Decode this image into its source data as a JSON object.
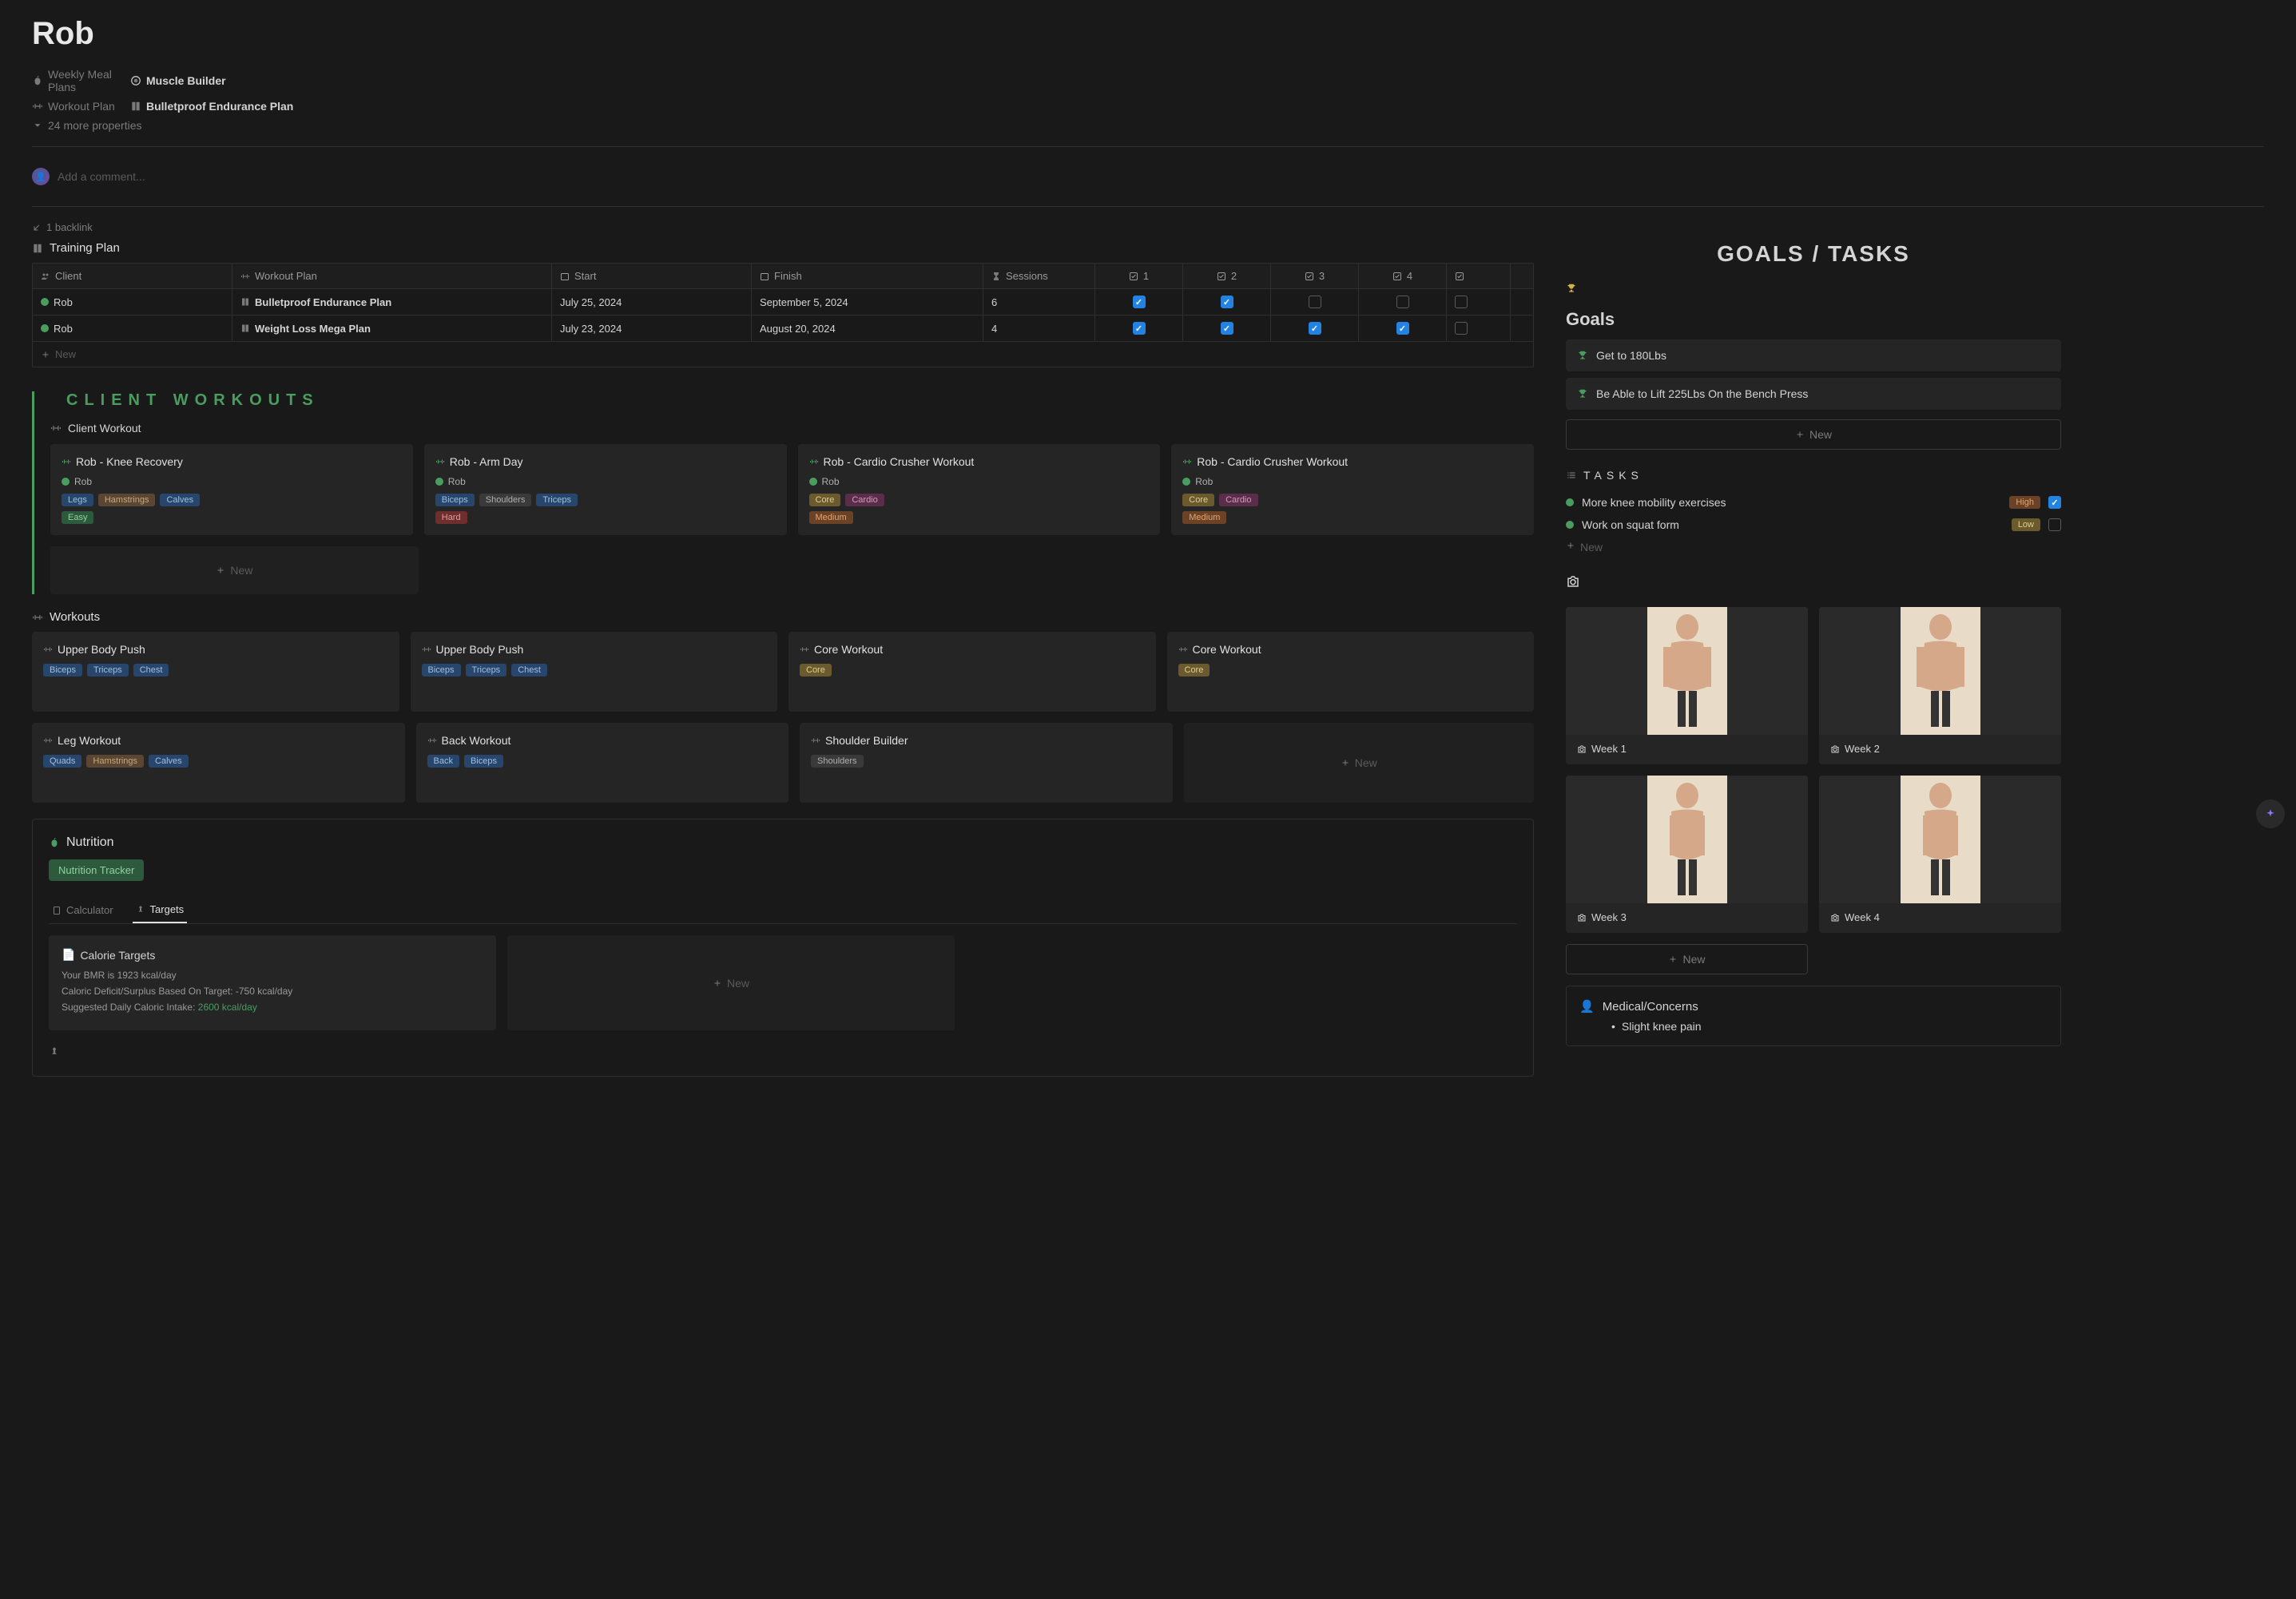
{
  "page": {
    "title": "Rob"
  },
  "properties": {
    "mealPlansLabel": "Weekly Meal Plans",
    "mealPlansValue": "Muscle Builder",
    "workoutPlanLabel": "Workout Plan",
    "workoutPlanValue": "Bulletproof Endurance Plan",
    "moreProps": "24 more properties"
  },
  "comment": {
    "placeholder": "Add a comment..."
  },
  "backlink": {
    "text": "1 backlink"
  },
  "trainingPlan": {
    "header": "Training Plan",
    "cols": {
      "client": "Client",
      "workout": "Workout Plan",
      "start": "Start",
      "finish": "Finish",
      "sessions": "Sessions",
      "c1": "1",
      "c2": "2",
      "c3": "3",
      "c4": "4"
    },
    "rows": [
      {
        "client": "Rob",
        "plan": "Bulletproof Endurance Plan",
        "start": "July 25, 2024",
        "finish": "September 5, 2024",
        "sessions": "6",
        "chk": [
          true,
          true,
          false,
          false,
          false
        ]
      },
      {
        "client": "Rob",
        "plan": "Weight Loss Mega Plan",
        "start": "July 23, 2024",
        "finish": "August 20, 2024",
        "sessions": "4",
        "chk": [
          true,
          true,
          true,
          true,
          false
        ]
      }
    ],
    "newLabel": "New"
  },
  "clientWorkouts": {
    "title": "CLIENT WORKOUTS",
    "subHeader": "Client Workout",
    "cards": [
      {
        "title": "Rob - Knee Recovery",
        "client": "Rob",
        "tags": [
          [
            "Legs",
            "blue"
          ],
          [
            "Hamstrings",
            "brown"
          ],
          [
            "Calves",
            "blue"
          ]
        ],
        "diff": [
          "Easy",
          "green"
        ]
      },
      {
        "title": "Rob - Arm Day",
        "client": "Rob",
        "tags": [
          [
            "Biceps",
            "blue"
          ],
          [
            "Shoulders",
            "gray"
          ],
          [
            "Triceps",
            "blue"
          ]
        ],
        "diff": [
          "Hard",
          "red"
        ]
      },
      {
        "title": "Rob - Cardio Crusher Workout",
        "client": "Rob",
        "tags": [
          [
            "Core",
            "yellow"
          ],
          [
            "Cardio",
            "pink"
          ]
        ],
        "diff": [
          "Medium",
          "orange"
        ]
      },
      {
        "title": "Rob - Cardio Crusher Workout",
        "client": "Rob",
        "tags": [
          [
            "Core",
            "yellow"
          ],
          [
            "Cardio",
            "pink"
          ]
        ],
        "diff": [
          "Medium",
          "orange"
        ]
      }
    ],
    "newLabel": "New"
  },
  "workouts": {
    "header": "Workouts",
    "cards": [
      {
        "title": "Upper Body Push",
        "tags": [
          [
            "Biceps",
            "blue"
          ],
          [
            "Triceps",
            "blue"
          ],
          [
            "Chest",
            "blue"
          ]
        ]
      },
      {
        "title": "Upper Body Push",
        "tags": [
          [
            "Biceps",
            "blue"
          ],
          [
            "Triceps",
            "blue"
          ],
          [
            "Chest",
            "blue"
          ]
        ]
      },
      {
        "title": "Core Workout",
        "tags": [
          [
            "Core",
            "yellow"
          ]
        ]
      },
      {
        "title": "Core Workout",
        "tags": [
          [
            "Core",
            "yellow"
          ]
        ]
      },
      {
        "title": "Leg Workout",
        "tags": [
          [
            "Quads",
            "blue"
          ],
          [
            "Hamstrings",
            "brown"
          ],
          [
            "Calves",
            "blue"
          ]
        ]
      },
      {
        "title": "Back Workout",
        "tags": [
          [
            "Back",
            "blue"
          ],
          [
            "Biceps",
            "blue"
          ]
        ]
      },
      {
        "title": "Shoulder Builder",
        "tags": [
          [
            "Shoulders",
            "gray"
          ]
        ]
      }
    ],
    "newLabel": "New"
  },
  "nutrition": {
    "header": "Nutrition",
    "tracker": "Nutrition Tracker",
    "tabs": {
      "calculator": "Calculator",
      "targets": "Targets"
    },
    "targetsCard": {
      "title": "Calorie Targets",
      "bmr": "Your BMR is 1923 kcal/day",
      "deficit": "Caloric Deficit/Surplus Based On Target: -750 kcal/day",
      "intakePrefix": "Suggested Daily Caloric Intake: ",
      "intakeValue": "2600 kcal/day"
    },
    "newLabel": "New"
  },
  "rightPanel": {
    "mainTitle": "GOALS / TASKS",
    "goalsHeader": "Goals",
    "goals": [
      "Get to 180Lbs",
      "Be Able to Lift 225Lbs On the Bench Press"
    ],
    "newLabel": "New",
    "tasksHeader": "TASKS",
    "tasks": [
      {
        "label": "More knee mobility exercises",
        "priority": "High",
        "priClass": "pri-high",
        "checked": true
      },
      {
        "label": "Work on squat form",
        "priority": "Low",
        "priClass": "pri-low",
        "checked": false
      }
    ],
    "photos": [
      "Week 1",
      "Week 2",
      "Week 3",
      "Week 4"
    ],
    "medical": {
      "header": "Medical/Concerns",
      "item": "Slight knee pain"
    }
  }
}
